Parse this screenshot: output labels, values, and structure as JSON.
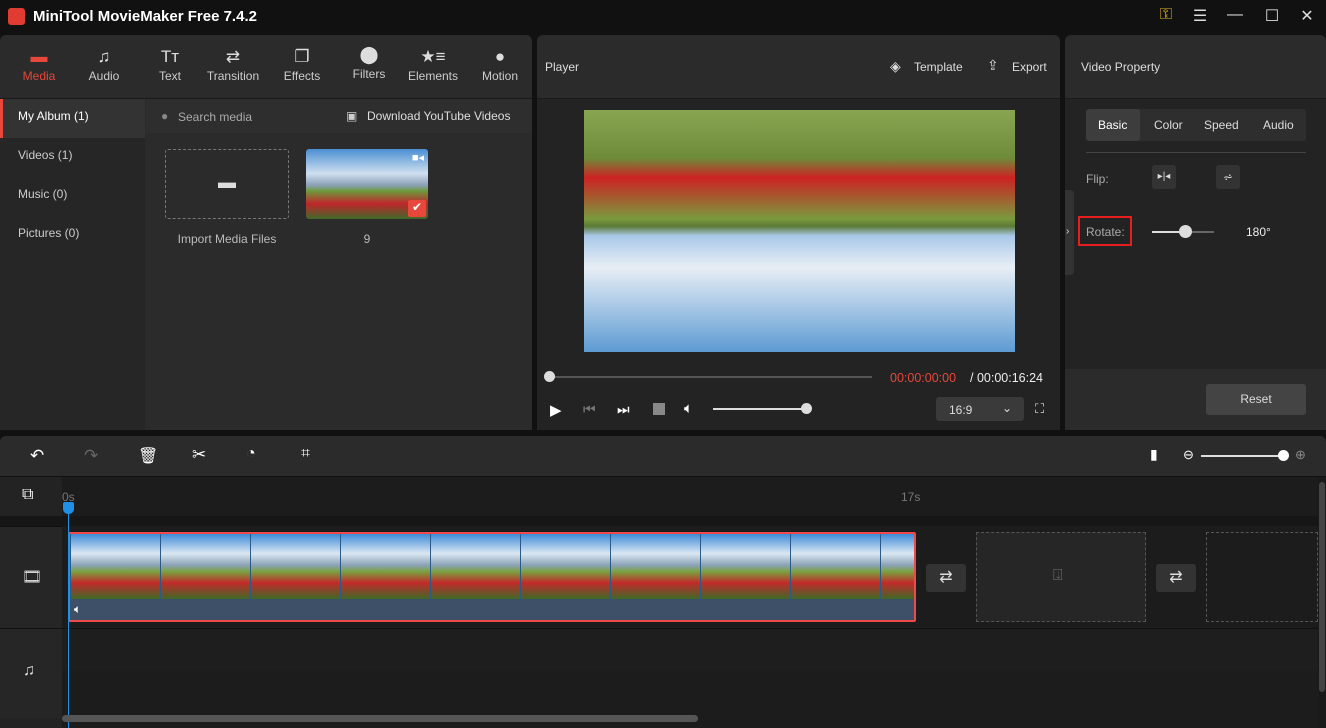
{
  "app": {
    "title": "MiniTool MovieMaker Free 7.4.2",
    "accent": "#e8473b"
  },
  "window_controls": {
    "key": "key-icon",
    "menu": "menu-icon",
    "minimize": "minimize-icon",
    "maximize": "maximize-icon",
    "close": "close-icon"
  },
  "tabs": [
    {
      "label": "Media",
      "icon": "folder-icon",
      "active": true
    },
    {
      "label": "Audio",
      "icon": "music-icon"
    },
    {
      "label": "Text",
      "icon": "text-icon"
    },
    {
      "label": "Transition",
      "icon": "transition-icon"
    },
    {
      "label": "Effects",
      "icon": "effects-icon"
    },
    {
      "label": "Filters",
      "icon": "filters-icon"
    },
    {
      "label": "Elements",
      "icon": "elements-icon"
    },
    {
      "label": "Motion",
      "icon": "motion-icon"
    }
  ],
  "sidebar": [
    {
      "label": "My Album (1)",
      "selected": true
    },
    {
      "label": "Videos (1)"
    },
    {
      "label": "Music (0)"
    },
    {
      "label": "Pictures (0)"
    }
  ],
  "media": {
    "search_placeholder": "Search media",
    "download_label": "Download YouTube Videos",
    "import_label": "Import Media Files",
    "clip_name": "9"
  },
  "player": {
    "title": "Player",
    "template_label": "Template",
    "export_label": "Export",
    "current_time": "00:00:00:00",
    "total_time": "/ 00:00:16:24",
    "aspect": "16:9",
    "volume": 0.9,
    "progress": 0
  },
  "property": {
    "title": "Video Property",
    "tabs": [
      "Basic",
      "Color",
      "Speed",
      "Audio"
    ],
    "active_tab": "Basic",
    "flip_label": "Flip:",
    "rotate_label": "Rotate:",
    "rotate_value": "180°",
    "rotate_fraction": 0.5,
    "reset_label": "Reset"
  },
  "timeline": {
    "ruler_start": "0s",
    "ruler_mark": "17s",
    "zoom_level": 1.0
  }
}
